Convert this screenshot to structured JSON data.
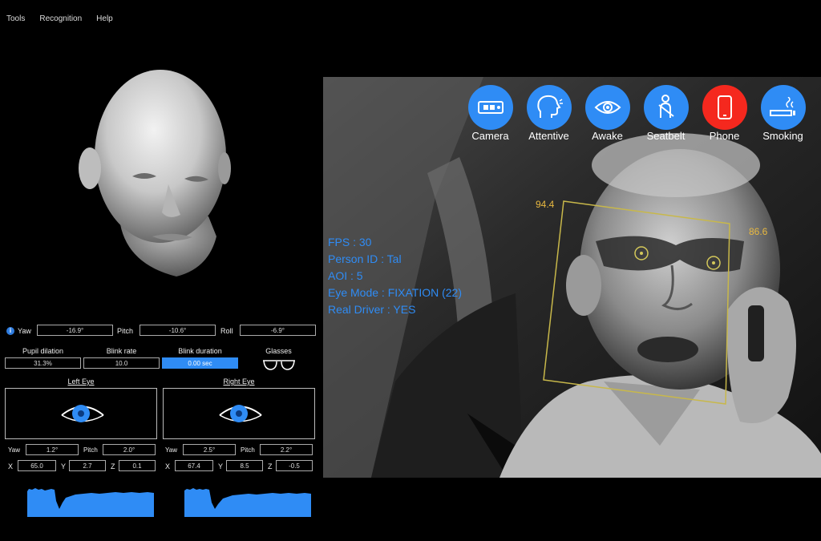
{
  "menu": {
    "items": [
      "Tools",
      "Recognition",
      "Help"
    ]
  },
  "pose": {
    "yaw_label": "Yaw",
    "yaw_value": "-16.9°",
    "pitch_label": "Pitch",
    "pitch_value": "-10.6°",
    "roll_label": "Roll",
    "roll_value": "-6.9°"
  },
  "metrics": {
    "pupil_label": "Pupil dilation",
    "pupil_value": "31.3%",
    "blink_rate_label": "Blink rate",
    "blink_rate_value": "10.0",
    "blink_duration_label": "Blink duration",
    "blink_duration_value": "0.00 sec",
    "glasses_label": "Glasses"
  },
  "left_eye": {
    "title": "Left  Eye",
    "yaw_label": "Yaw",
    "yaw_value": "1.2°",
    "pitch_label": "Pitch",
    "pitch_value": "2.0°",
    "x_label": "X",
    "x_value": "65.0",
    "y_label": "Y",
    "y_value": "2.7",
    "z_label": "Z",
    "z_value": "0.1"
  },
  "right_eye": {
    "title": "Right  Eye",
    "yaw_label": "Yaw",
    "yaw_value": "2.5°",
    "pitch_label": "Pitch",
    "pitch_value": "2.2°",
    "x_label": "X",
    "x_value": "67.4",
    "y_label": "Y",
    "y_value": "8.5",
    "z_label": "Z",
    "z_value": "-0.5"
  },
  "status_icons": [
    {
      "label": "Camera",
      "icon": "camera-icon",
      "color": "#2f8cf5"
    },
    {
      "label": "Attentive",
      "icon": "attentive-head-icon",
      "color": "#2f8cf5"
    },
    {
      "label": "Awake",
      "icon": "eye-icon",
      "color": "#2f8cf5"
    },
    {
      "label": "Seatbelt",
      "icon": "seatbelt-icon",
      "color": "#2f8cf5"
    },
    {
      "label": "Phone",
      "icon": "phone-icon",
      "color": "#f5281e"
    },
    {
      "label": "Smoking",
      "icon": "smoking-icon",
      "color": "#2f8cf5"
    }
  ],
  "overlay": {
    "fps": "FPS : 30",
    "person_id": "Person ID : Tal",
    "aoi": "AOI : 5",
    "eye_mode": "Eye Mode : FIXATION (22)",
    "real_driver": "Real Driver : YES"
  },
  "face_box": {
    "top_left_score": "94.4",
    "top_right_score": "86.6"
  },
  "colors": {
    "accent": "#2f8cf5",
    "alert": "#f5281e",
    "score": "#e8b840"
  }
}
